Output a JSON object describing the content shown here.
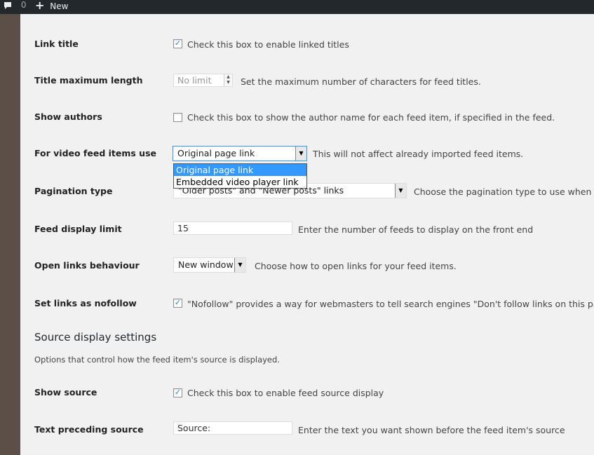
{
  "adminbar": {
    "comments_count": "0",
    "new_label": "New"
  },
  "rows": {
    "link_title": {
      "label": "Link title",
      "checked": true,
      "desc": "Check this box to enable linked titles"
    },
    "title_max": {
      "label": "Title maximum length",
      "placeholder": "No limit",
      "desc": "Set the maximum number of characters for feed titles."
    },
    "show_authors": {
      "label": "Show authors",
      "checked": false,
      "desc": "Check this box to show the author name for each feed item, if specified in the feed."
    },
    "video": {
      "label": "For video feed items use",
      "value": "Original page link",
      "options": [
        "Original page link",
        "Embedded video player link"
      ],
      "desc": "This will not affect already imported feed items."
    },
    "pagination": {
      "label": "Pagination type",
      "value": "\"Older posts\" and \"Newer posts\" links",
      "desc": "Choose the pagination type to use when disp"
    },
    "display_limit": {
      "label": "Feed display limit",
      "value": "15",
      "desc": "Enter the number of feeds to display on the front end"
    },
    "open_links": {
      "label": "Open links behaviour",
      "value": "New window",
      "desc": "Choose how to open links for your feed items."
    },
    "nofollow": {
      "label": "Set links as nofollow",
      "checked": true,
      "desc": "\"Nofollow\" provides a way for webmasters to tell search engines \"Don't follow links on this page\" or"
    }
  },
  "source_section": {
    "title": "Source display settings",
    "desc": "Options that control how the feed item's source is displayed."
  },
  "source_rows": {
    "show_source": {
      "label": "Show source",
      "checked": true,
      "desc": "Check this box to enable feed source display"
    },
    "preceding": {
      "label": "Text preceding source",
      "value": "Source:",
      "desc": "Enter the text you want shown before the feed item's source"
    }
  },
  "icons": {
    "comment": "comment-bubble-icon",
    "plus": "plus-icon",
    "check": "checkmark-icon",
    "arrow": "dropdown-arrow-icon"
  }
}
